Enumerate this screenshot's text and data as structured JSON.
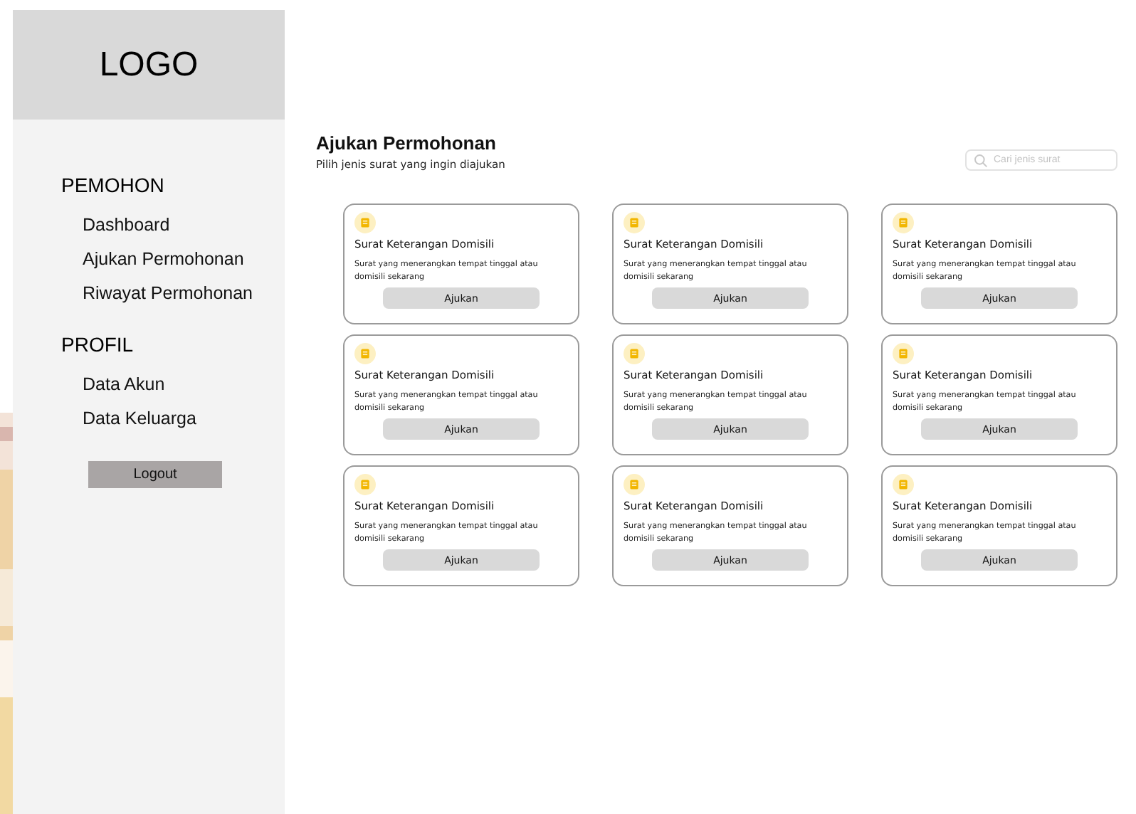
{
  "sidebar": {
    "logo": "LOGO",
    "sections": [
      {
        "heading": "PEMOHON",
        "items": [
          {
            "label": "Dashboard"
          },
          {
            "label": "Ajukan Permohonan"
          },
          {
            "label": "Riwayat Permohonan"
          }
        ]
      },
      {
        "heading": "PROFIL",
        "items": [
          {
            "label": "Data Akun"
          },
          {
            "label": "Data Keluarga"
          }
        ]
      }
    ],
    "logout": "Logout"
  },
  "header": {
    "title": "Ajukan Permohonan",
    "subtitle": "Pilih jenis surat yang ingin diajukan"
  },
  "search": {
    "placeholder": "Cari jenis surat"
  },
  "cards": [
    {
      "title": "Surat Keterangan Domisili",
      "description": "Surat yang menerangkan tempat tinggal atau domisili sekarang",
      "button": "Ajukan"
    },
    {
      "title": "Surat Keterangan Domisili",
      "description": "Surat yang menerangkan tempat tinggal atau domisili sekarang",
      "button": "Ajukan"
    },
    {
      "title": "Surat Keterangan Domisili",
      "description": "Surat yang menerangkan tempat tinggal atau domisili sekarang",
      "button": "Ajukan"
    },
    {
      "title": "Surat Keterangan Domisili",
      "description": "Surat yang menerangkan tempat tinggal atau domisili sekarang",
      "button": "Ajukan"
    },
    {
      "title": "Surat Keterangan Domisili",
      "description": "Surat yang menerangkan tempat tinggal atau domisili sekarang",
      "button": "Ajukan"
    },
    {
      "title": "Surat Keterangan Domisili",
      "description": "Surat yang menerangkan tempat tinggal atau domisili sekarang",
      "button": "Ajukan"
    },
    {
      "title": "Surat Keterangan Domisili",
      "description": "Surat yang menerangkan tempat tinggal atau domisili sekarang",
      "button": "Ajukan"
    },
    {
      "title": "Surat Keterangan Domisili",
      "description": "Surat yang menerangkan tempat tinggal atau domisili sekarang",
      "button": "Ajukan"
    },
    {
      "title": "Surat Keterangan Domisili",
      "description": "Surat yang menerangkan tempat tinggal atau domisili sekarang",
      "button": "Ajukan"
    }
  ]
}
